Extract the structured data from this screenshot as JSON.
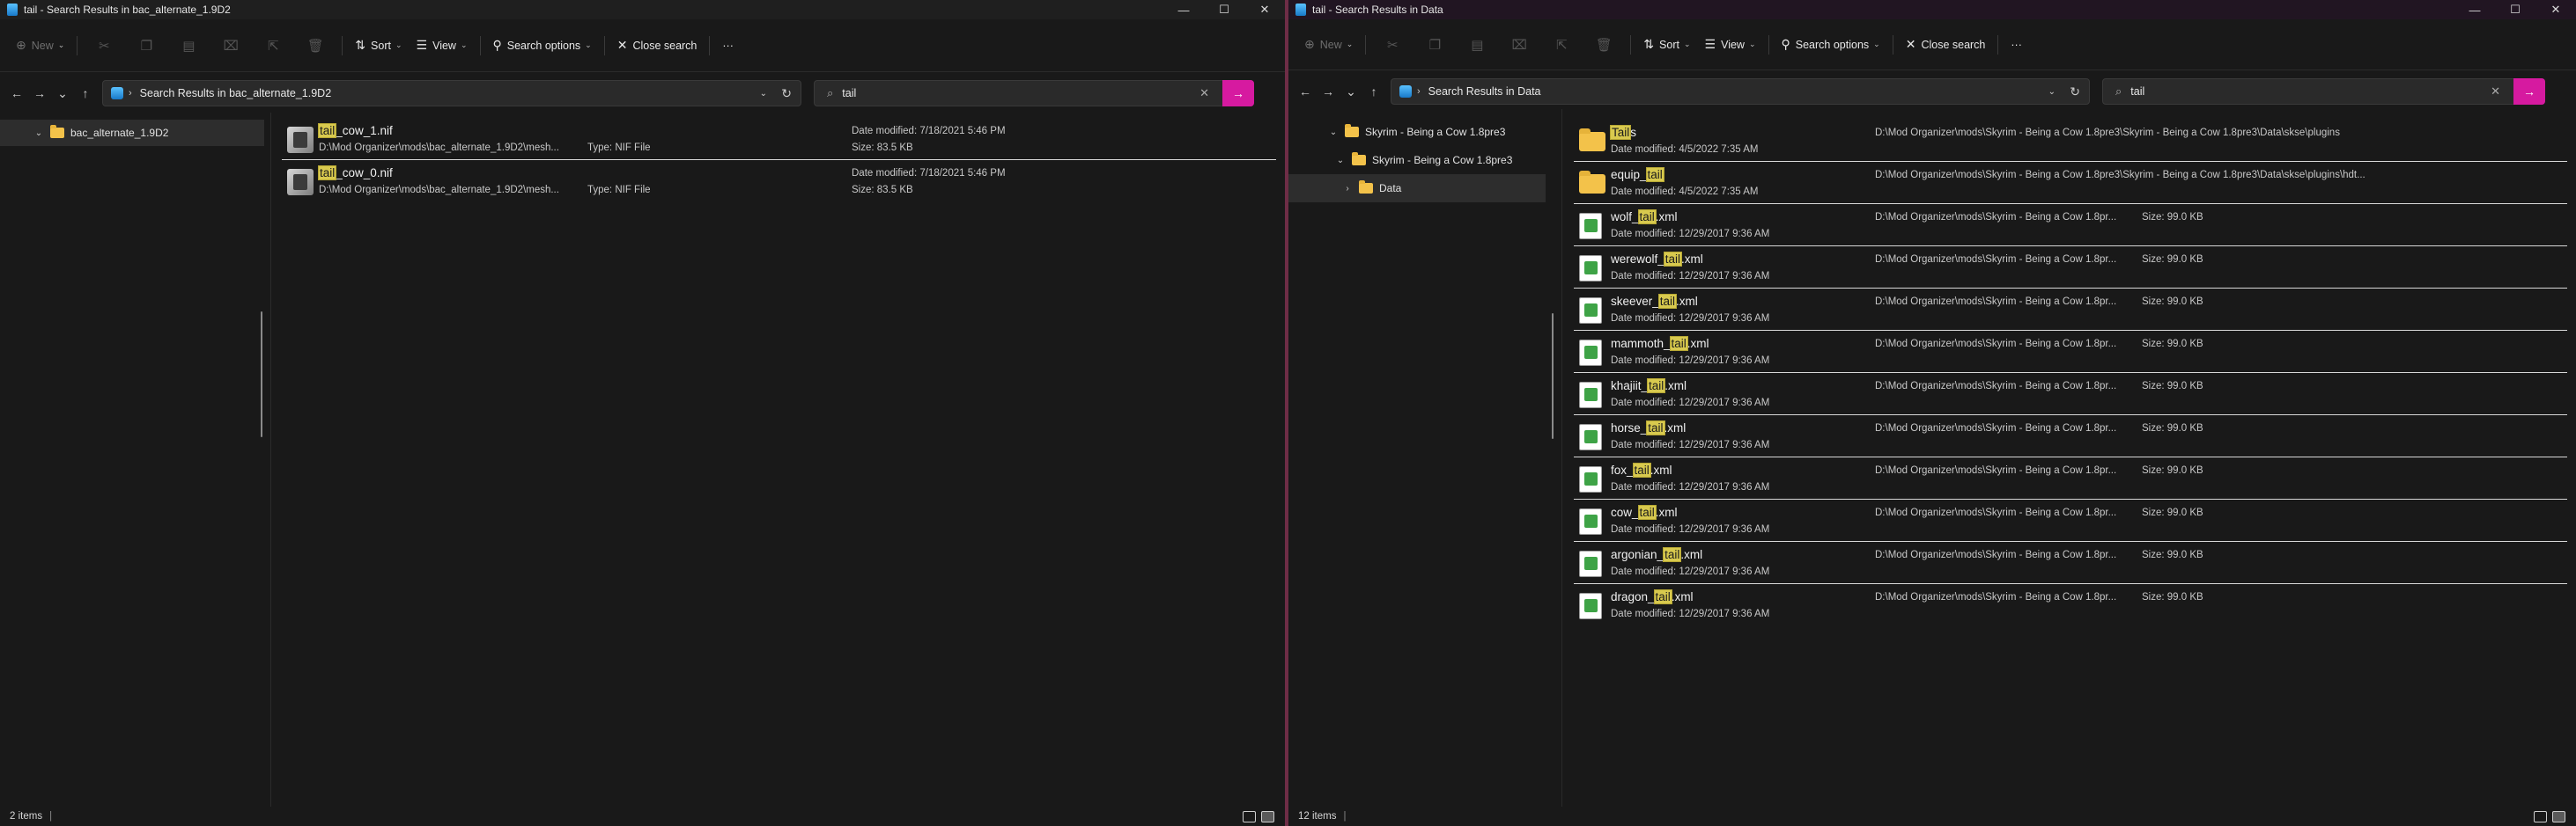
{
  "left": {
    "title": "tail - Search Results in bac_alternate_1.9D2",
    "toolbar": {
      "new": "New",
      "sort": "Sort",
      "view": "View",
      "search_options": "Search options",
      "close_search": "Close search",
      "more": "···"
    },
    "address": "Search Results in bac_alternate_1.9D2",
    "search_query": "tail",
    "tree": [
      {
        "label": "bac_alternate_1.9D2"
      }
    ],
    "files": [
      {
        "hl": "tail",
        "rest": "_cow_1.nif",
        "path": "D:\\Mod Organizer\\mods\\bac_alternate_1.9D2\\mesh...",
        "type": "Type: NIF File",
        "modified": "Date modified: 7/18/2021 5:46 PM",
        "size": "Size: 83.5 KB"
      },
      {
        "hl": "tail",
        "rest": "_cow_0.nif",
        "path": "D:\\Mod Organizer\\mods\\bac_alternate_1.9D2\\mesh...",
        "type": "Type: NIF File",
        "modified": "Date modified: 7/18/2021 5:46 PM",
        "size": "Size: 83.5 KB"
      }
    ],
    "status": "2 items"
  },
  "right": {
    "title": "tail - Search Results in Data",
    "toolbar": {
      "new": "New",
      "sort": "Sort",
      "view": "View",
      "search_options": "Search options",
      "close_search": "Close search",
      "more": "···"
    },
    "address": "Search Results in Data",
    "search_query": "tail",
    "tree": [
      {
        "label": "Skyrim - Being a Cow 1.8pre3"
      },
      {
        "label": "Skyrim - Being a Cow 1.8pre3"
      },
      {
        "label": "Data"
      }
    ],
    "files": [
      {
        "pre": "",
        "hl": "Tail",
        "rest": "s",
        "modified": "Date modified: 4/5/2022 7:35 AM",
        "path": "D:\\Mod Organizer\\mods\\Skyrim - Being a Cow 1.8pre3\\Skyrim - Being a Cow 1.8pre3\\Data\\skse\\plugins",
        "size": ""
      },
      {
        "pre": "equip_",
        "hl": "tail",
        "rest": "",
        "modified": "Date modified: 4/5/2022 7:35 AM",
        "path": "D:\\Mod Organizer\\mods\\Skyrim - Being a Cow 1.8pre3\\Skyrim - Being a Cow 1.8pre3\\Data\\skse\\plugins\\hdt...",
        "size": ""
      },
      {
        "pre": "wolf_",
        "hl": "tail",
        "rest": ".xml",
        "modified": "Date modified: 12/29/2017 9:36 AM",
        "path": "D:\\Mod Organizer\\mods\\Skyrim - Being a Cow 1.8pr...",
        "size": "Size: 99.0 KB"
      },
      {
        "pre": "werewolf_",
        "hl": "tail",
        "rest": ".xml",
        "modified": "Date modified: 12/29/2017 9:36 AM",
        "path": "D:\\Mod Organizer\\mods\\Skyrim - Being a Cow 1.8pr...",
        "size": "Size: 99.0 KB"
      },
      {
        "pre": "skeever_",
        "hl": "tail",
        "rest": ".xml",
        "modified": "Date modified: 12/29/2017 9:36 AM",
        "path": "D:\\Mod Organizer\\mods\\Skyrim - Being a Cow 1.8pr...",
        "size": "Size: 99.0 KB"
      },
      {
        "pre": "mammoth_",
        "hl": "tail",
        "rest": ".xml",
        "modified": "Date modified: 12/29/2017 9:36 AM",
        "path": "D:\\Mod Organizer\\mods\\Skyrim - Being a Cow 1.8pr...",
        "size": "Size: 99.0 KB"
      },
      {
        "pre": "khajiit_",
        "hl": "tail",
        "rest": ".xml",
        "modified": "Date modified: 12/29/2017 9:36 AM",
        "path": "D:\\Mod Organizer\\mods\\Skyrim - Being a Cow 1.8pr...",
        "size": "Size: 99.0 KB"
      },
      {
        "pre": "horse_",
        "hl": "tail",
        "rest": ".xml",
        "modified": "Date modified: 12/29/2017 9:36 AM",
        "path": "D:\\Mod Organizer\\mods\\Skyrim - Being a Cow 1.8pr...",
        "size": "Size: 99.0 KB"
      },
      {
        "pre": "fox_",
        "hl": "tail",
        "rest": ".xml",
        "modified": "Date modified: 12/29/2017 9:36 AM",
        "path": "D:\\Mod Organizer\\mods\\Skyrim - Being a Cow 1.8pr...",
        "size": "Size: 99.0 KB"
      },
      {
        "pre": "cow_",
        "hl": "tail",
        "rest": ".xml",
        "modified": "Date modified: 12/29/2017 9:36 AM",
        "path": "D:\\Mod Organizer\\mods\\Skyrim - Being a Cow 1.8pr...",
        "size": "Size: 99.0 KB"
      },
      {
        "pre": "argonian_",
        "hl": "tail",
        "rest": ".xml",
        "modified": "Date modified: 12/29/2017 9:36 AM",
        "path": "D:\\Mod Organizer\\mods\\Skyrim - Being a Cow 1.8pr...",
        "size": "Size: 99.0 KB"
      },
      {
        "pre": "dragon_",
        "hl": "tail",
        "rest": ".xml",
        "modified": "Date modified: 12/29/2017 9:36 AM",
        "path": "D:\\Mod Organizer\\mods\\Skyrim - Being a Cow 1.8pr...",
        "size": "Size: 99.0 KB"
      }
    ],
    "status": "12 items"
  },
  "colors": {
    "accent": "#d61aa0",
    "highlight": "#d8c94e",
    "folder": "#f3c24a",
    "background": "#191919"
  }
}
